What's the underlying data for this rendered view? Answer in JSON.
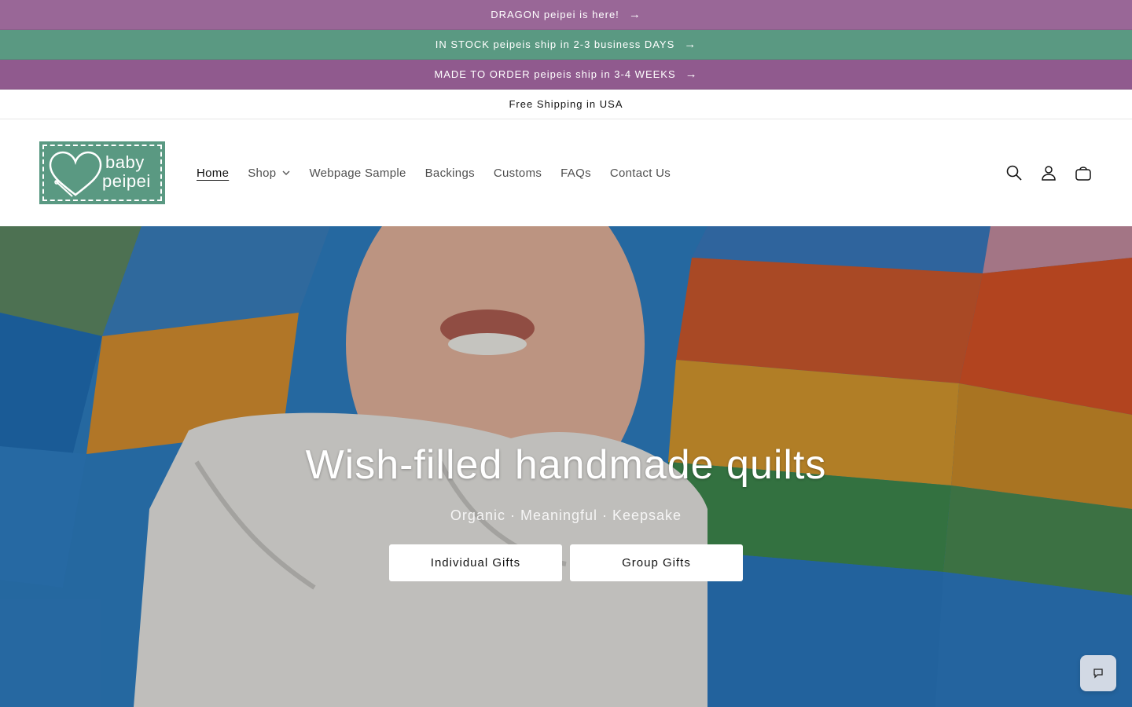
{
  "announcements": [
    {
      "text": "DRAGON peipei is here!",
      "arrow": "→"
    },
    {
      "text": "IN STOCK peipeis ship in 2-3 business DAYS",
      "arrow": "→"
    },
    {
      "text": "MADE TO ORDER peipeis ship in 3-4 WEEKS",
      "arrow": "→"
    },
    {
      "text": "Free Shipping in USA"
    }
  ],
  "logo": {
    "line1": "baby",
    "line2": "peipei",
    "bg_color": "#5a9982"
  },
  "nav": {
    "items": [
      {
        "label": "Home",
        "active": true
      },
      {
        "label": "Shop",
        "has_dropdown": true
      },
      {
        "label": "Webpage Sample"
      },
      {
        "label": "Backings"
      },
      {
        "label": "Customs"
      },
      {
        "label": "FAQs"
      },
      {
        "label": "Contact Us"
      }
    ]
  },
  "header_icons": [
    "search-icon",
    "account-icon",
    "cart-icon"
  ],
  "hero": {
    "title": "Wish-filled handmade quilts",
    "subtitle": "Organic · Meaningful · Keepsake",
    "buttons": [
      "Individual Gifts",
      "Group Gifts"
    ]
  },
  "chat": {
    "icon": "chat-icon"
  },
  "colors": {
    "purple": "#996797",
    "green": "#5a9982",
    "purple_dark": "#905a8e"
  }
}
